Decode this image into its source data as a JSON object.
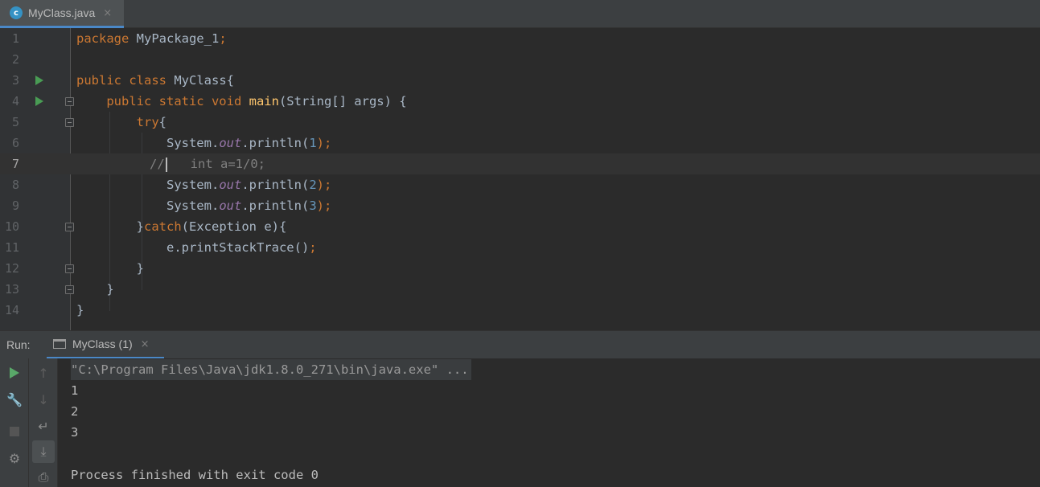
{
  "editor_tab": {
    "title": "MyClass.java",
    "icon": "java-class-icon",
    "close": "×"
  },
  "editor": {
    "lines": [
      {
        "num": "1",
        "text": "package MyPackage_1;"
      },
      {
        "num": "2",
        "text": ""
      },
      {
        "num": "3",
        "text": "public class MyClass{"
      },
      {
        "num": "4",
        "text": "    public static void main(String[] args) {"
      },
      {
        "num": "5",
        "text": "        try{"
      },
      {
        "num": "6",
        "text": "            System.out.println(1);"
      },
      {
        "num": "7",
        "text": "//    int a=1/0;"
      },
      {
        "num": "8",
        "text": "            System.out.println(2);"
      },
      {
        "num": "9",
        "text": "            System.out.println(3);"
      },
      {
        "num": "10",
        "text": "        }catch(Exception e){"
      },
      {
        "num": "11",
        "text": "            e.printStackTrace();"
      },
      {
        "num": "12",
        "text": "        }"
      },
      {
        "num": "13",
        "text": "    }"
      },
      {
        "num": "14",
        "text": "}"
      }
    ],
    "current_line": "7",
    "run_gutter_lines": [
      "3",
      "4"
    ]
  },
  "run_panel": {
    "label": "Run:",
    "tab_title": "MyClass (1)",
    "tab_close": "×",
    "toolbar_icons": [
      "rerun-icon",
      "up-arrow-icon",
      "wrench-icon",
      "down-arrow-icon",
      "stop-icon",
      "soft-wrap-icon",
      "settings-icon",
      "scroll-to-end-icon",
      "print-icon"
    ]
  },
  "console": {
    "command": "\"C:\\Program Files\\Java\\jdk1.8.0_271\\bin\\java.exe\" ...",
    "output": [
      "1",
      "2",
      "3",
      "",
      "Process finished with exit code 0"
    ]
  },
  "colors": {
    "keyword": "#cc7832",
    "method": "#ffc66d",
    "number": "#6897bb",
    "static_field": "#9876aa",
    "comment": "#808080",
    "text": "#a9b7c6",
    "background": "#2b2b2b"
  }
}
